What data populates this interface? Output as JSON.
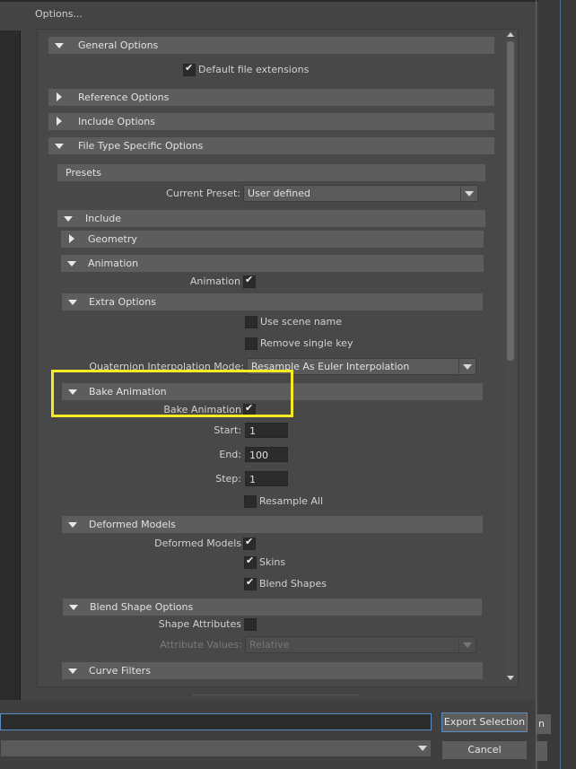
{
  "dialog": {
    "title": "Options..."
  },
  "sections": {
    "general": {
      "label": "General Options",
      "default_file_extensions": "Default file extensions"
    },
    "reference": {
      "label": "Reference Options"
    },
    "include_opts": {
      "label": "Include Options"
    },
    "file_type": {
      "label": "File Type Specific Options"
    },
    "presets": {
      "label": "Presets",
      "current_preset_label": "Current Preset:",
      "current_preset_value": "User defined"
    },
    "include": {
      "label": "Include"
    },
    "geometry": {
      "label": "Geometry"
    },
    "animation": {
      "label": "Animation",
      "animation_label": "Animation"
    },
    "extra": {
      "label": "Extra Options",
      "use_scene_name": "Use scene name",
      "remove_single_key": "Remove single key",
      "quat_label": "Quaternion Interpolation Mode:",
      "quat_value": "Resample As Euler Interpolation"
    },
    "bake": {
      "label": "Bake Animation",
      "bake_label": "Bake Animation",
      "start_label": "Start:",
      "start_value": "1",
      "end_label": "End:",
      "end_value": "100",
      "step_label": "Step:",
      "step_value": "1",
      "resample_all": "Resample All"
    },
    "deformed": {
      "label": "Deformed Models",
      "deformed_label": "Deformed Models",
      "skins": "Skins",
      "blend_shapes": "Blend Shapes"
    },
    "blend_shape": {
      "label": "Blend Shape Options",
      "shape_attributes": "Shape Attributes",
      "attribute_values_label": "Attribute Values:",
      "attribute_values_value": "Relative"
    },
    "curve_filters": {
      "label": "Curve Filters"
    }
  },
  "buttons": {
    "export_selection": "Export Selection",
    "cancel": "Cancel",
    "edge_partial": "n"
  },
  "colors": {
    "highlight": "#f5eb22",
    "accent_border": "#5b8cc4"
  }
}
